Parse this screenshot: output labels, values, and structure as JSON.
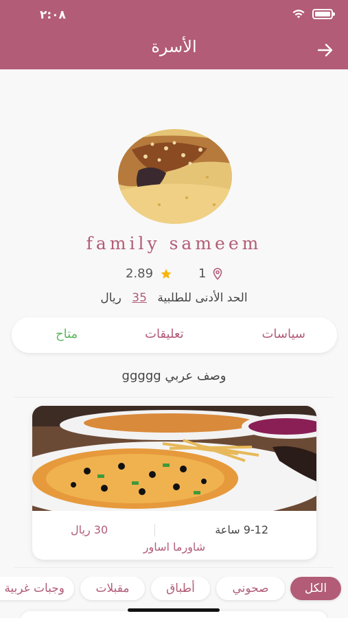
{
  "status": {
    "time": "٢:٠٨"
  },
  "header": {
    "title": "الأسرة",
    "back_icon": "arrow-right-icon"
  },
  "colors": {
    "brand": "#b25c77",
    "available": "#5bb85c",
    "star": "#f5b50a"
  },
  "family": {
    "name": "family sameem",
    "rating": "2.89",
    "location_count": "1",
    "min_order_label": "الحد الأدنى للطلبية",
    "min_order_amount": "35",
    "min_order_currency": "ريال"
  },
  "info_tabs": {
    "policies": "سياسات",
    "comments": "تعليقات",
    "status": "متاح"
  },
  "description": "وصف عربي  ggggg",
  "product": {
    "prep_time": "9-12 ساعة",
    "price": "30 ريال",
    "name": "شاورما اساور"
  },
  "categories": [
    {
      "label": "الكل",
      "active": true
    },
    {
      "label": "صحوني",
      "active": false
    },
    {
      "label": "أطباق",
      "active": false
    },
    {
      "label": "مقبلات",
      "active": false
    },
    {
      "label": "وجبات غربية",
      "active": false
    }
  ]
}
